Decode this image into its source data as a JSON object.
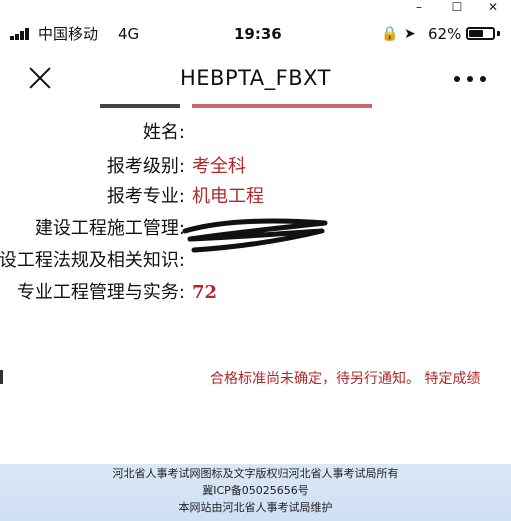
{
  "window": {
    "min": "–",
    "max": "☐",
    "close": "✕"
  },
  "status": {
    "carrier": "中国移动",
    "network": "4G",
    "time": "19:36",
    "battery": "62%",
    "battery_level": 0.62
  },
  "nav": {
    "title": "HEBPTA_FBXT"
  },
  "rows": [
    {
      "label": "姓名:",
      "value": ""
    },
    {
      "label": "报考级别:",
      "value": "考全科"
    },
    {
      "label": "报考专业:",
      "value": "机电工程"
    },
    {
      "label": "建设工程施工管理:",
      "value": ""
    },
    {
      "label": "建设工程法规及相关知识:",
      "value": ""
    },
    {
      "label": "专业工程管理与实务:",
      "value": "72"
    }
  ],
  "notice": "合格标准尚未确定，待另行通知。 特定成绩",
  "footer": {
    "line1": "河北省人事考试网图标及文字版权归河北省人事考试局所有",
    "line2": "冀ICP备05025656号",
    "line3": "本网站由河北省人事考试局维护"
  },
  "colors": {
    "accent": "#b0282b",
    "footer_bg": "#d6e3f6"
  }
}
